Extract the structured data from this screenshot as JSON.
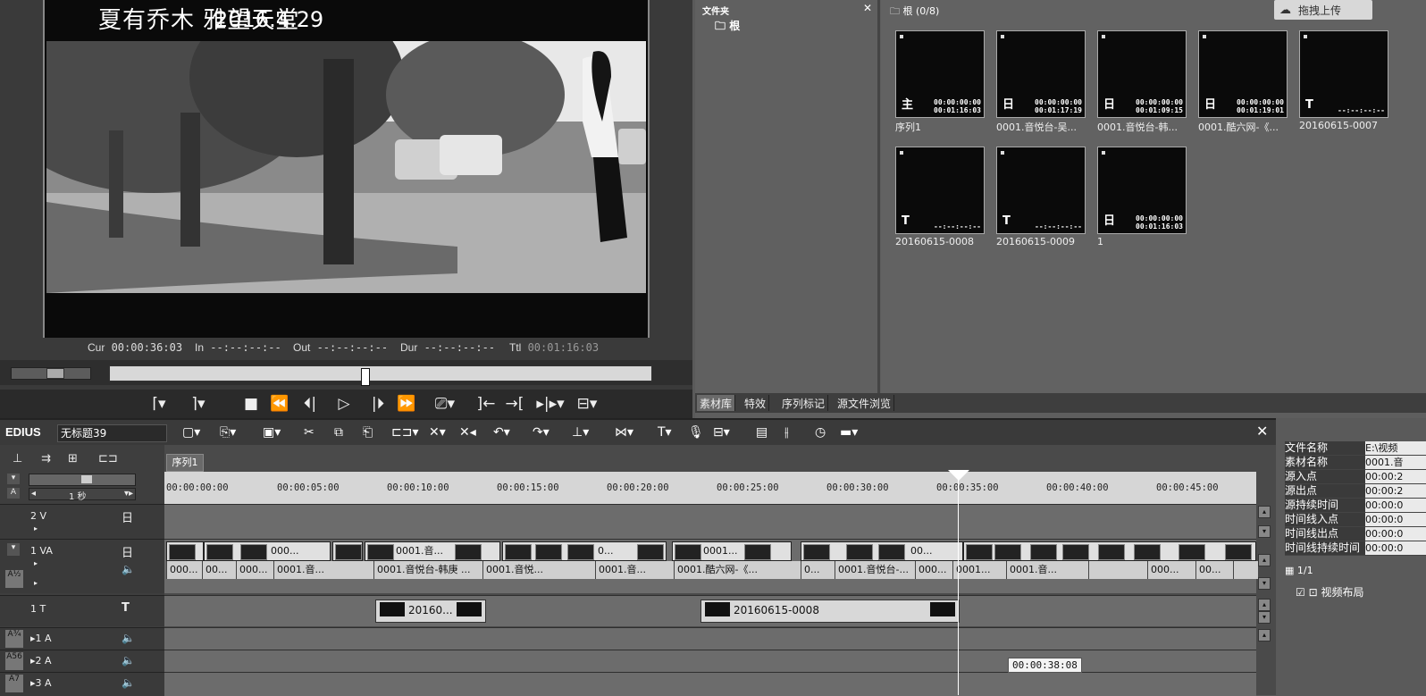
{
  "player": {
    "overlay_title": "夏有乔木 雅望天堂",
    "overlay_date": "2016.4.29",
    "timecodes": [
      {
        "label": "Cur",
        "value": "00:00:36:03"
      },
      {
        "label": "In",
        "value": "--:--:--:--"
      },
      {
        "label": "Out",
        "value": "--:--:--:--"
      },
      {
        "label": "Dur",
        "value": "--:--:--:--"
      },
      {
        "label": "Ttl",
        "value": "00:01:16:03"
      }
    ],
    "position_fraction": 0.47
  },
  "bin": {
    "folder_title": "文件夹",
    "folder_root": "根",
    "clips_title": "根 (0/8)",
    "upload_label": "拖拽上传",
    "clips": [
      {
        "name": "序列1",
        "type_icon": "主",
        "tc1": "00:00:00:00",
        "tc2": "00:01:16:03"
      },
      {
        "name": "0001.音悦台-吴...",
        "type_icon": "日",
        "tc1": "00:00:00:00",
        "tc2": "00:01:17:19"
      },
      {
        "name": "0001.音悦台-韩...",
        "type_icon": "日",
        "tc1": "00:00:00:00",
        "tc2": "00:01:09:15"
      },
      {
        "name": "0001.酷六网-《...",
        "type_icon": "日",
        "tc1": "00:00:00:00",
        "tc2": "00:01:19:01"
      },
      {
        "name": "20160615-0007",
        "type_icon": "T",
        "tc1": "",
        "tc2": "--:--:--:--"
      },
      {
        "name": "20160615-0008",
        "type_icon": "T",
        "tc1": "",
        "tc2": "--:--:--:--"
      },
      {
        "name": "20160615-0009",
        "type_icon": "T",
        "tc1": "",
        "tc2": "--:--:--:--"
      },
      {
        "name": "1",
        "type_icon": "日",
        "tc1": "00:00:00:00",
        "tc2": "00:01:16:03"
      }
    ],
    "tabs": [
      "素材库",
      "特效",
      "序列标记",
      "源文件浏览"
    ]
  },
  "timeline": {
    "logo": "EDIUS",
    "project_name": "无标题39",
    "sequence_tab": "序列1",
    "zoom_label": "1 秒",
    "ruler": [
      "00:00:00:00",
      "00:00:05:00",
      "00:00:10:00",
      "00:00:15:00",
      "00:00:20:00",
      "00:00:25:00",
      "00:00:30:00",
      "00:00:35:00",
      "00:00:40:00",
      "00:00:45:00"
    ],
    "tracks": {
      "v2": "2 V",
      "va1": "1 VA",
      "t1": "1 T",
      "a1": "▸1 A",
      "a2": "▸2 A",
      "a3": "▸3 A"
    },
    "video_clip_labels": [
      "000...",
      "0001.音...",
      "0...",
      "0001...",
      "00..."
    ],
    "audio_clip_labels": [
      "000...",
      "00...",
      "0001.音...",
      "0001.音悦台-韩庚 ...",
      "0001.音悦...",
      "0001.音...",
      "0001.酷六网-《...",
      "0...",
      "0001.音悦台-...",
      "000...",
      "0001...",
      "0001.音..."
    ],
    "title_clips": [
      "20160...",
      "20160615-0008"
    ],
    "hover_timecode": "00:00:38:08"
  },
  "info": {
    "rows": [
      {
        "k": "文件名称",
        "v": "E:\\视频"
      },
      {
        "k": "素材名称",
        "v": "0001.音"
      },
      {
        "k": "源入点",
        "v": "00:00:2"
      },
      {
        "k": "源出点",
        "v": "00:00:2"
      },
      {
        "k": "源持续时间",
        "v": "00:00:0"
      },
      {
        "k": "时间线入点",
        "v": "00:00:0"
      },
      {
        "k": "时间线出点",
        "v": "00:00:0"
      },
      {
        "k": "时间线持续时间",
        "v": "00:00:0"
      }
    ],
    "page": "1/1",
    "layout_label": "视频布局"
  }
}
